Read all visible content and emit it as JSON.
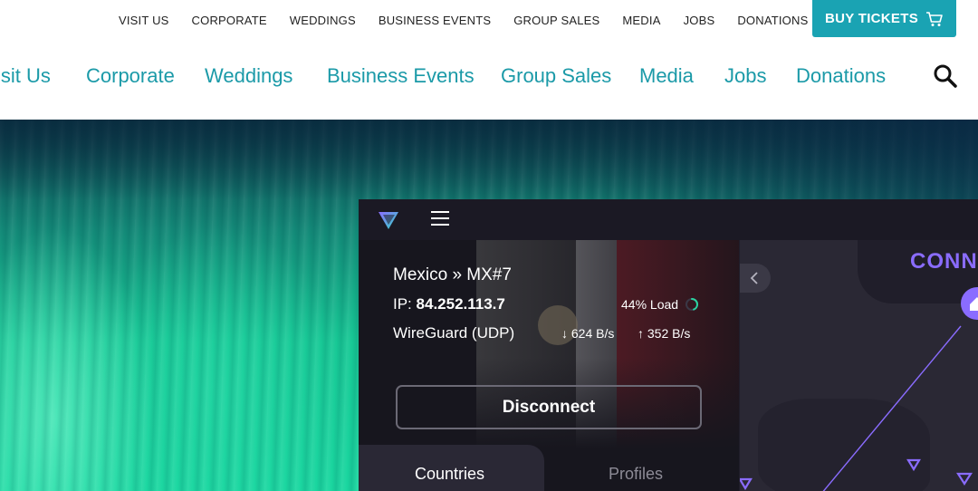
{
  "topbar": {
    "links": [
      "VISIT US",
      "CORPORATE",
      "WEDDINGS",
      "BUSINESS EVENTS",
      "GROUP SALES",
      "MEDIA",
      "JOBS",
      "DONATIONS"
    ],
    "buy_label": "BUY TICKETS"
  },
  "mainnav": {
    "items": [
      "isit Us",
      "Corporate",
      "Weddings",
      "Business Events",
      "Group Sales",
      "Media",
      "Jobs",
      "Donations"
    ]
  },
  "vpn": {
    "server": "Mexico » MX#7",
    "ip_label": "IP:",
    "ip": "84.252.113.7",
    "load": "44% Load",
    "load_fraction": 0.44,
    "protocol": "WireGuard (UDP)",
    "download": "624 B/s",
    "upload": "352 B/s",
    "disconnect_label": "Disconnect",
    "tabs": [
      "Countries",
      "Profiles"
    ],
    "status": "CONN",
    "accent": "#8a6cff"
  },
  "colors": {
    "teal": "#1aa3b3",
    "nav_text": "#1b9aa8"
  }
}
